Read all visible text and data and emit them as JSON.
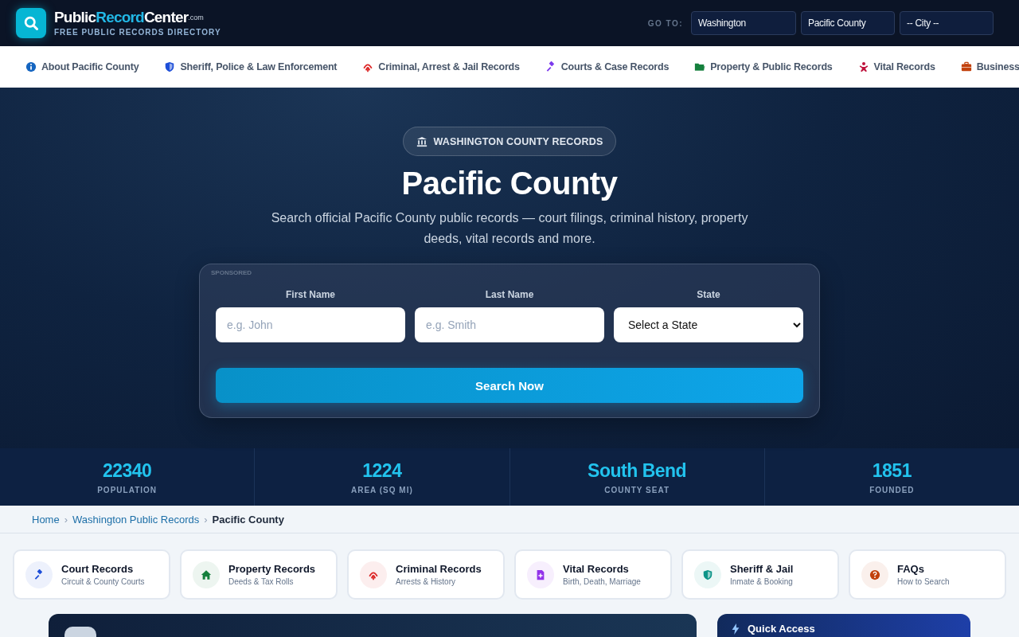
{
  "header": {
    "logo": {
      "part_1": "Public",
      "part_2": "Record",
      "part_3": "Center",
      "suffix": ".com",
      "tagline": "FREE PUBLIC RECORDS DIRECTORY"
    },
    "goto_label": "GO TO:",
    "selects": [
      "Washington",
      "Pacific County",
      "-- City --"
    ]
  },
  "nav": [
    {
      "label": "About Pacific County",
      "color": "#1565c0"
    },
    {
      "label": "Sheriff, Police & Law Enforcement",
      "color": "#1d4ed8"
    },
    {
      "label": "Criminal, Arrest & Jail Records",
      "color": "#dc2626"
    },
    {
      "label": "Courts & Case Records",
      "color": "#7c3aed"
    },
    {
      "label": "Property & Public Records",
      "color": "#15803d"
    },
    {
      "label": "Vital Records",
      "color": "#be123c"
    },
    {
      "label": "Business",
      "color": "#c2410c"
    }
  ],
  "hero": {
    "badge": "WASHINGTON COUNTY RECORDS",
    "title": "Pacific County",
    "subtitle": "Search official Pacific County public records — court filings, criminal history, property deeds, vital records and more.",
    "search_form": {
      "sponsored": "SPONSORED",
      "fields": [
        {
          "kind": "input",
          "label": "First Name",
          "placeholder": "e.g. John"
        },
        {
          "kind": "input",
          "label": "Last Name",
          "placeholder": "e.g. Smith"
        },
        {
          "kind": "select",
          "label": "State",
          "value": "Select a State"
        }
      ],
      "button": "Search Now"
    }
  },
  "stats": [
    {
      "value": "22340",
      "label": "POPULATION"
    },
    {
      "value": "1224",
      "label": "AREA (SQ MI)"
    },
    {
      "value": "South Bend",
      "label": "COUNTY SEAT"
    },
    {
      "value": "1851",
      "label": "FOUNDED"
    }
  ],
  "breadcrumb": [
    {
      "label": "Home",
      "current": false
    },
    {
      "separator": "›",
      "label": "Washington Public Records",
      "current": false
    },
    {
      "separator": "›",
      "label": "Pacific County",
      "current": true
    }
  ],
  "quick_cards": [
    {
      "title": "Court Records",
      "subtitle": "Circuit & County Courts",
      "color": "#1d4ed8"
    },
    {
      "title": "Property Records",
      "subtitle": "Deeds & Tax Rolls",
      "color": "#15803d"
    },
    {
      "title": "Criminal Records",
      "subtitle": "Arrests & History",
      "color": "#dc2626"
    },
    {
      "title": "Vital Records",
      "subtitle": "Birth, Death, Marriage",
      "color": "#9333ea"
    },
    {
      "title": "Sheriff & Jail",
      "subtitle": "Inmate & Booking",
      "color": "#0d9488"
    },
    {
      "title": "FAQs",
      "subtitle": "How to Search",
      "color": "#c2410c"
    }
  ],
  "quick_access": {
    "title": "Quick Access"
  }
}
